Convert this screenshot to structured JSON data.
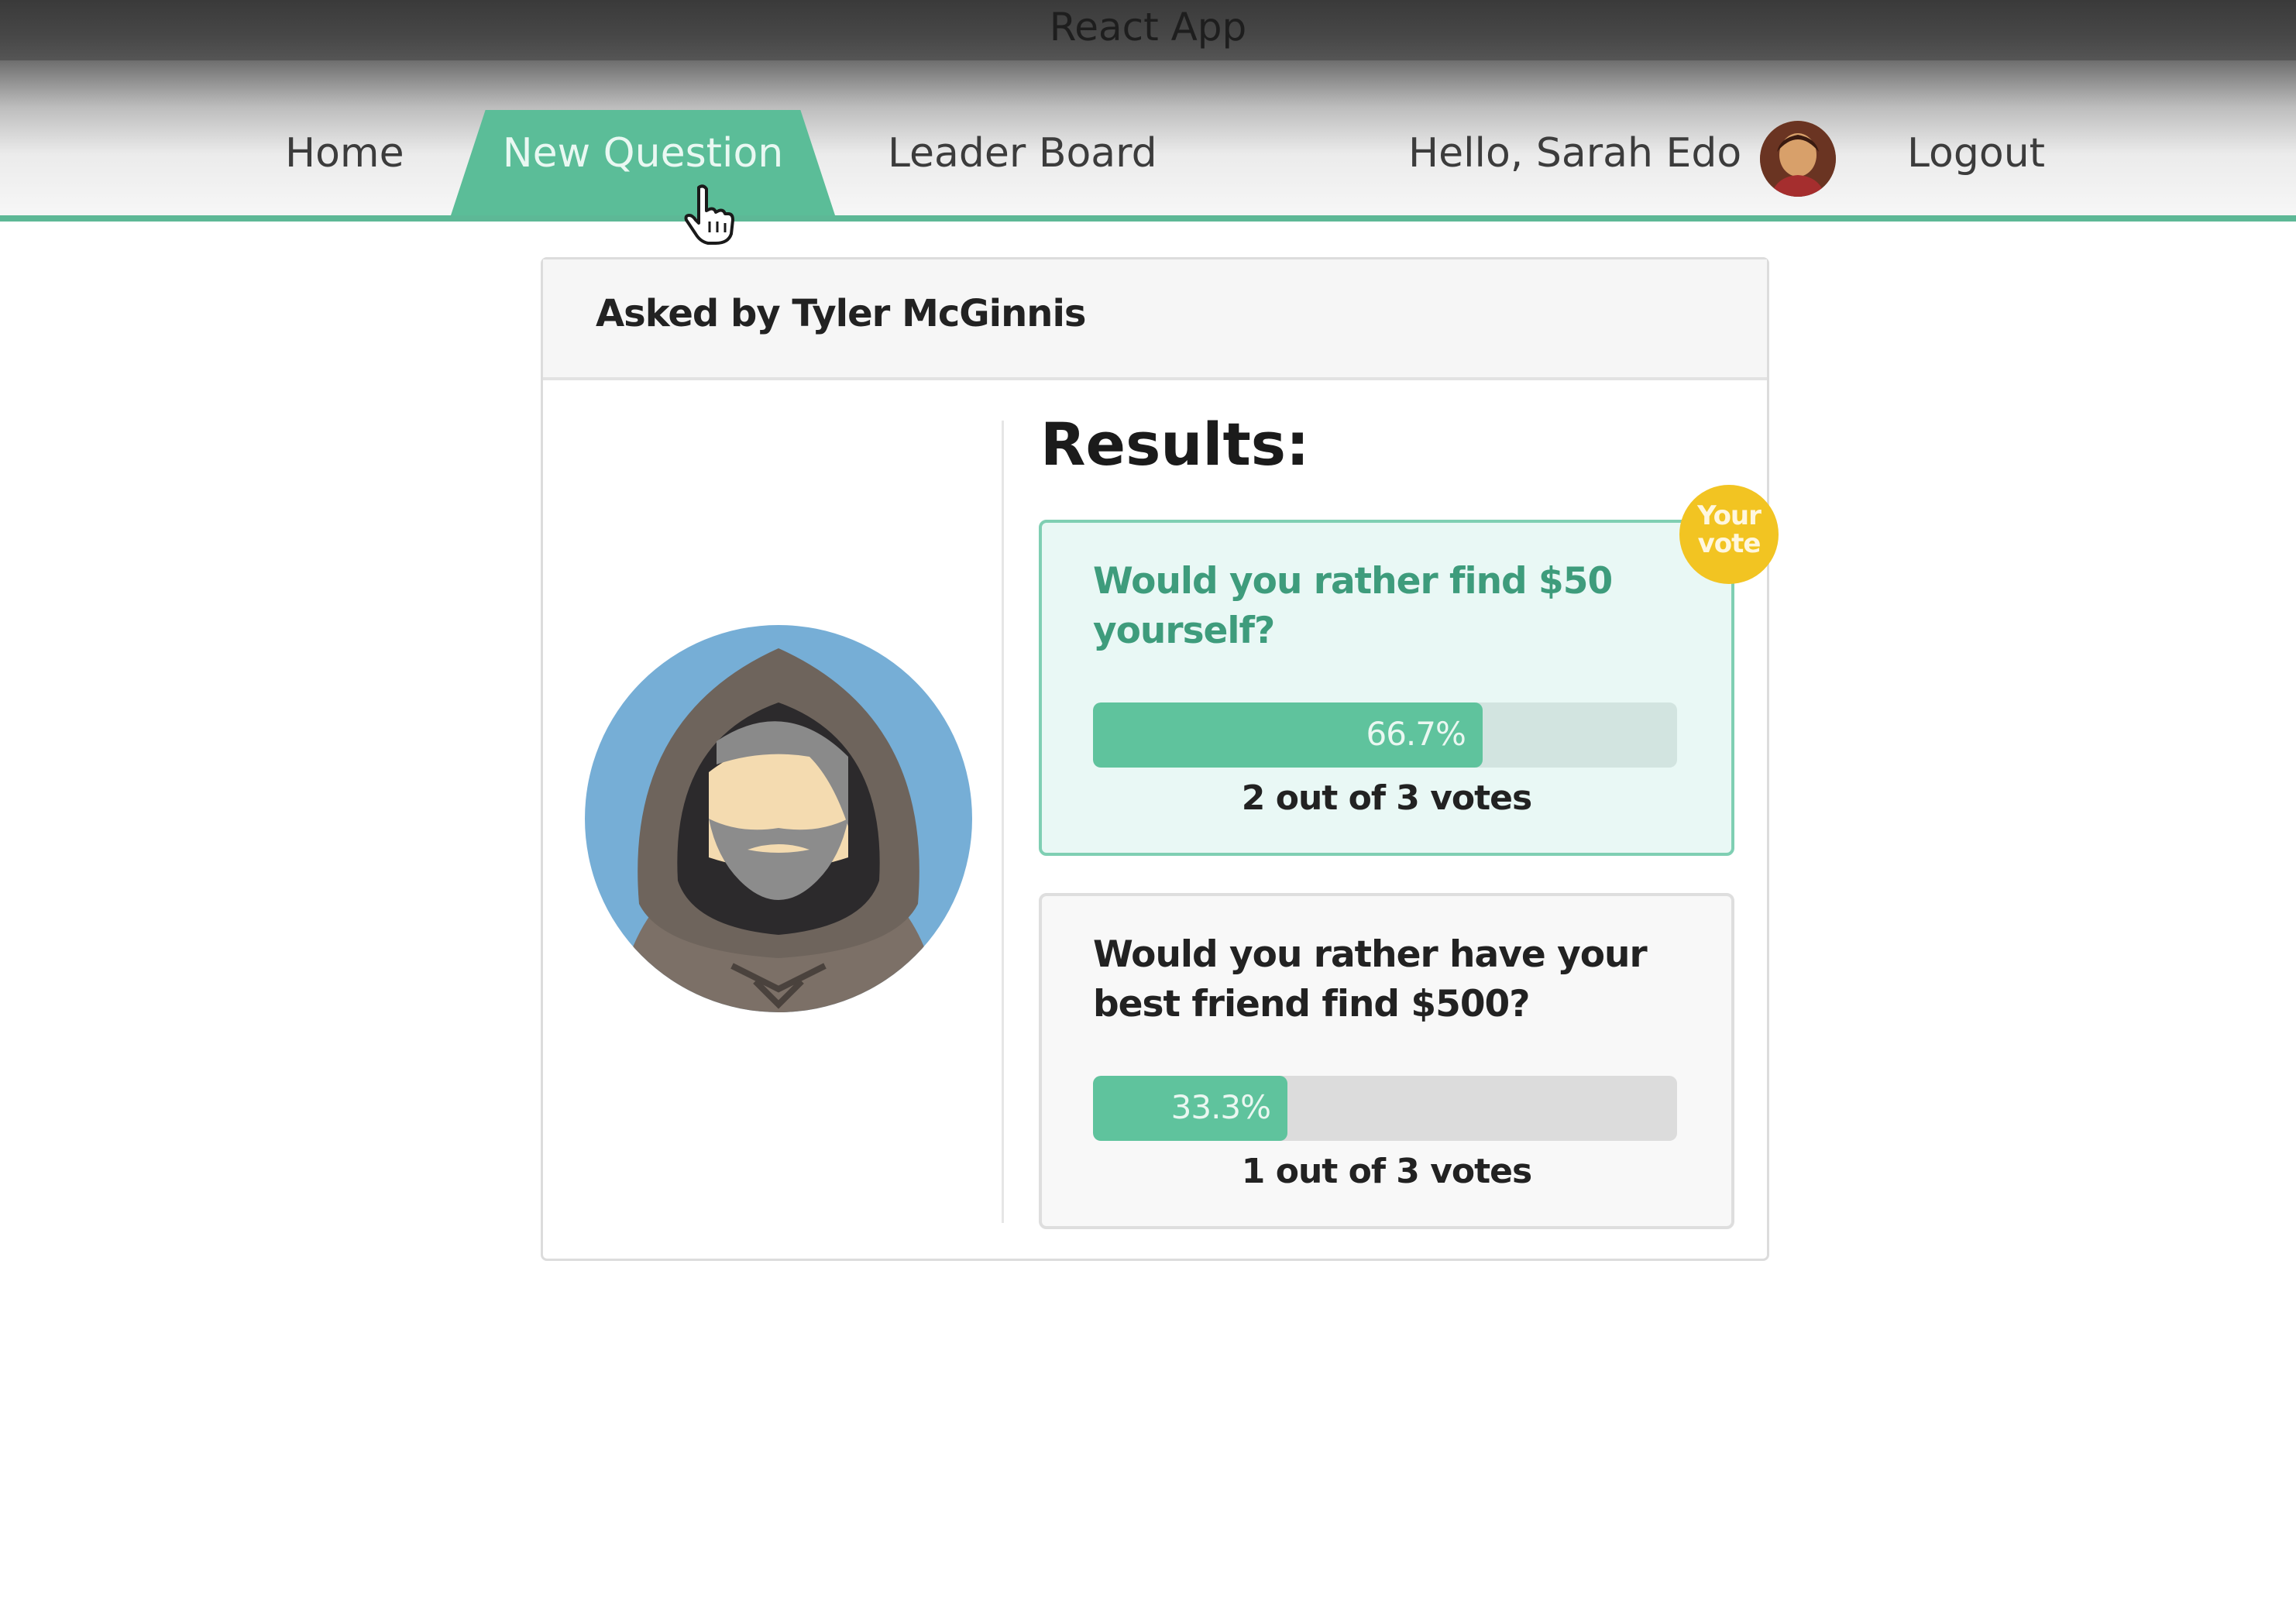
{
  "window": {
    "title": "React App"
  },
  "nav": {
    "home": "Home",
    "new_question": "New Question",
    "leader_board": "Leader Board",
    "greeting": "Hello, Sarah Edo",
    "logout": "Logout",
    "accent_color": "#5bbd98"
  },
  "question": {
    "asked_by": "Asked by Tyler McGinnis",
    "results_title": "Results:",
    "your_vote_badge": "Your vote",
    "options": [
      {
        "text": "Would you rather find $50 yourself?",
        "percent": 66.7,
        "percent_label": "66.7%",
        "votes": "2 out of 3 votes",
        "is_user_vote": true
      },
      {
        "text": "Would you rather have your best friend find $500?",
        "percent": 33.3,
        "percent_label": "33.3%",
        "votes": "1 out of 3 votes",
        "is_user_vote": false
      }
    ]
  },
  "colors": {
    "bar_fill": "#5fc39d",
    "badge": "#f2c422",
    "selected_option_bg": "#e9f8f5"
  }
}
